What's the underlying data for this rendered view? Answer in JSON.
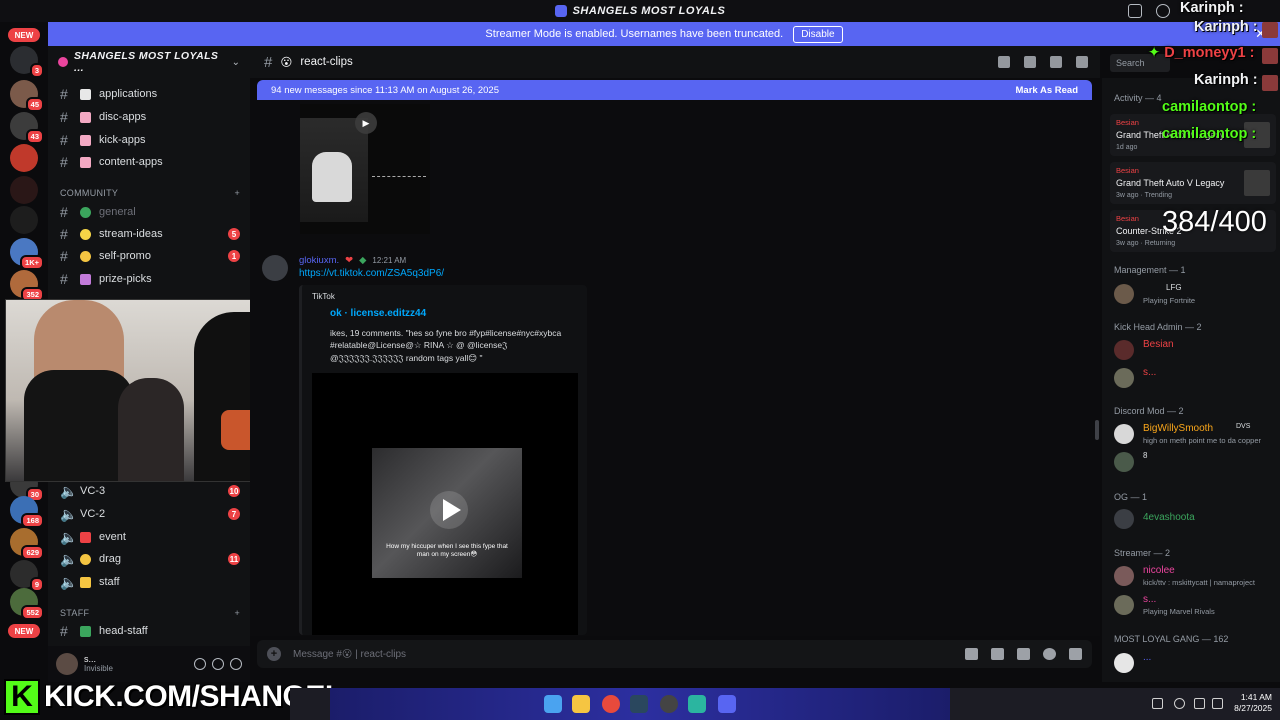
{
  "window": {
    "title": "SHANGELS MOST LOYALS"
  },
  "banner": {
    "text": "Streamer Mode is enabled. Usernames have been truncated.",
    "disable_label": "Disable",
    "close": "✕"
  },
  "rail": {
    "new_label": "NEW",
    "new_label_bottom": "NEW",
    "badges": [
      "3",
      "45",
      "43",
      "1K+",
      "352",
      "30",
      "168",
      "629",
      "9",
      "552"
    ]
  },
  "server": {
    "name": "SHANGELS MOST LOYALS ..."
  },
  "channels_top": [
    {
      "label": "applications"
    },
    {
      "label": "disc-apps"
    },
    {
      "label": "kick-apps"
    },
    {
      "label": "content-apps"
    }
  ],
  "category_community": "COMMUNITY",
  "channels_community": [
    {
      "label": "general",
      "badge": ""
    },
    {
      "label": "stream-ideas",
      "badge": "5"
    },
    {
      "label": "self-promo",
      "badge": "1"
    },
    {
      "label": "prize-picks",
      "badge": ""
    }
  ],
  "voice_channels": [
    {
      "label": "VC-3",
      "badge": "10"
    },
    {
      "label": "VC-2",
      "badge": "7"
    },
    {
      "label": "event",
      "badge": ""
    },
    {
      "label": "drag",
      "badge": "11"
    },
    {
      "label": "staff",
      "badge": ""
    }
  ],
  "category_staff": "STAFF",
  "channels_staff": [
    {
      "label": "head-staff"
    }
  ],
  "user_panel": {
    "name": "s...",
    "status": "Invisible"
  },
  "chat": {
    "channel": "react-clips",
    "search_placeholder": "Search",
    "new_messages": "94 new messages since 11:13 AM on August 26, 2025",
    "mark_read": "Mark As Read",
    "message": {
      "author": "glokiuxm.",
      "time": "12:21 AM",
      "link": "https://vt.tiktok.com/ZSA5q3dP6/",
      "embed_provider": "TikTok",
      "embed_title": "ok · license.editzz44",
      "embed_desc": "ikes, 19 comments. \"hes so fyne bro #fyp#license#nyc#xybca #relatable@License@☆ RINA ☆ @ @license𝔍 @𝔍𝔍𝔍𝔍𝔍𝔍.𝔍𝔍𝔍𝔍𝔍𝔍 random tags yall😊 \"",
      "video_caption": "How my hiccuper when I see this fype that man on my screen😳"
    },
    "composer_placeholder": "Message #😮 | react-clips"
  },
  "members": {
    "activity_header": "Activity — 4",
    "activities": [
      {
        "who": "Besian",
        "game": "Grand Theft Auto V Legacy",
        "meta": "1d ago"
      },
      {
        "who": "Besian",
        "game": "Grand Theft Auto V Legacy",
        "meta": "3w ago · Trending"
      },
      {
        "who": "Besian",
        "game": "Counter-Strike 2",
        "meta": "3w ago · Returning"
      }
    ],
    "sections": [
      {
        "title": "Management — 1",
        "members": [
          {
            "name": "",
            "tag": "LFG",
            "status": "Playing Fortnite"
          }
        ]
      },
      {
        "title": "Kick Head Admin — 2",
        "members": [
          {
            "name": "Besian",
            "status": ""
          },
          {
            "name": "s...",
            "status": ""
          }
        ]
      },
      {
        "title": "Discord Mod — 2",
        "members": [
          {
            "name": "BigWillySmooth",
            "tag": "DVS",
            "status": "high on meth point me to da copper"
          },
          {
            "name": "8",
            "status": ""
          }
        ]
      },
      {
        "title": "OG — 1",
        "members": [
          {
            "name": "4evashoota",
            "status": ""
          }
        ]
      },
      {
        "title": "Streamer — 2",
        "members": [
          {
            "name": "nicolee",
            "status": "kick/ttv : mskittycatt | namaproject"
          },
          {
            "name": "s...",
            "status": "Playing Marvel Rivals"
          }
        ]
      },
      {
        "title": "MOST LOYAL GANG — 162",
        "members": [
          {
            "name": "...",
            "status": ""
          }
        ]
      }
    ]
  },
  "overlay": {
    "chat": [
      "Karinph :",
      "Karinph :",
      "D_moneyy1 :",
      "Karinph :",
      "camilaontop :",
      "camilaontop :"
    ],
    "counter": "384/400",
    "kick": "KICK.COM/SHANGEL"
  },
  "taskbar": {
    "time": "1:41 AM",
    "date": "8/27/2025"
  },
  "colors": {
    "accent": "#5865f2",
    "danger": "#ed4245",
    "kick_green": "#53fc18"
  }
}
